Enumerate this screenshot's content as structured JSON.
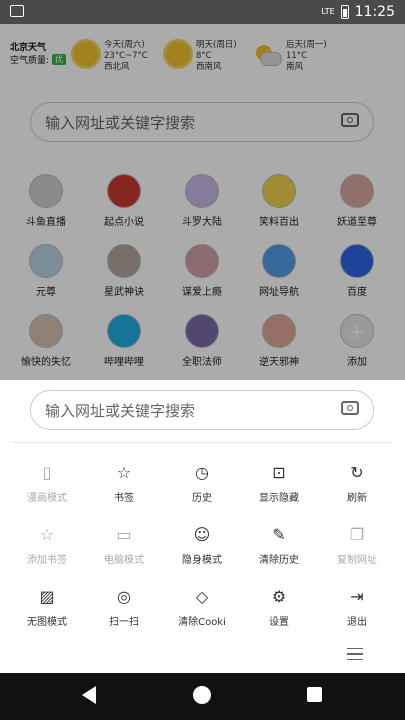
{
  "status": {
    "time": "11:25",
    "network": "LTE"
  },
  "weather": {
    "city": "北京天气",
    "air_label": "空气质量:",
    "air_value": "优",
    "days": [
      {
        "day": "今天(周六)",
        "temp": "23°C~7°C",
        "wind": "西北风",
        "icon": "sun-icon"
      },
      {
        "day": "明天(周日)",
        "temp": "8°C",
        "wind": "西南风",
        "icon": "sun-icon"
      },
      {
        "day": "后天(周一)",
        "temp": "11°C",
        "wind": "南风",
        "icon": "cloud-sun-icon"
      }
    ]
  },
  "search": {
    "placeholder": "输入网址或关键字搜索"
  },
  "apps": [
    {
      "label": "斗鱼直播",
      "color": "#cfcfcf"
    },
    {
      "label": "起点小说",
      "color": "#c83a32"
    },
    {
      "label": "斗罗大陆",
      "color": "#c8b8e8"
    },
    {
      "label": "笑料百出",
      "color": "#f1d050"
    },
    {
      "label": "妖道至尊",
      "color": "#d8a8a0"
    },
    {
      "label": "元尊",
      "color": "#b9d2e6"
    },
    {
      "label": "星武神诀",
      "color": "#b2a69c"
    },
    {
      "label": "谋爱上瘾",
      "color": "#cfa0a8"
    },
    {
      "label": "网址导航",
      "color": "#4f9be8"
    },
    {
      "label": "百度",
      "color": "#2f65e6"
    },
    {
      "label": "愉快的失忆",
      "color": "#d6c0b0"
    },
    {
      "label": "哔哩哔哩",
      "color": "#23ade5"
    },
    {
      "label": "全职法师",
      "color": "#7a6aa8"
    },
    {
      "label": "逆天邪神",
      "color": "#e0a898"
    },
    {
      "label": "添加",
      "color": "#e6e6e6"
    }
  ],
  "menu": [
    {
      "label": "漫画模式",
      "icon": "book-icon",
      "glyph": "▯",
      "enabled": false
    },
    {
      "label": "书签",
      "icon": "star-icon",
      "glyph": "☆",
      "enabled": true
    },
    {
      "label": "历史",
      "icon": "clock-icon",
      "glyph": "◷",
      "enabled": true
    },
    {
      "label": "显示隐藏",
      "icon": "lock-icon",
      "glyph": "⊡",
      "enabled": true
    },
    {
      "label": "刷新",
      "icon": "refresh-icon",
      "glyph": "↻",
      "enabled": true
    },
    {
      "label": "添加书签",
      "icon": "star-add-icon",
      "glyph": "☆",
      "enabled": false
    },
    {
      "label": "电脑模式",
      "icon": "monitor-icon",
      "glyph": "▭",
      "enabled": false
    },
    {
      "label": "隐身模式",
      "icon": "mask-icon",
      "glyph": "☺",
      "enabled": true
    },
    {
      "label": "清除历史",
      "icon": "broom-icon",
      "glyph": "✎",
      "enabled": true
    },
    {
      "label": "复制网址",
      "icon": "copy-icon",
      "glyph": "❐",
      "enabled": false
    },
    {
      "label": "无图模式",
      "icon": "image-icon",
      "glyph": "▨",
      "enabled": true
    },
    {
      "label": "扫一扫",
      "icon": "camera-icon",
      "glyph": "◎",
      "enabled": true
    },
    {
      "label": "清除Cooki",
      "icon": "eraser-icon",
      "glyph": "◇",
      "enabled": true
    },
    {
      "label": "设置",
      "icon": "gear-icon",
      "glyph": "⚙",
      "enabled": true
    },
    {
      "label": "退出",
      "icon": "exit-icon",
      "glyph": "⇥",
      "enabled": true
    }
  ]
}
